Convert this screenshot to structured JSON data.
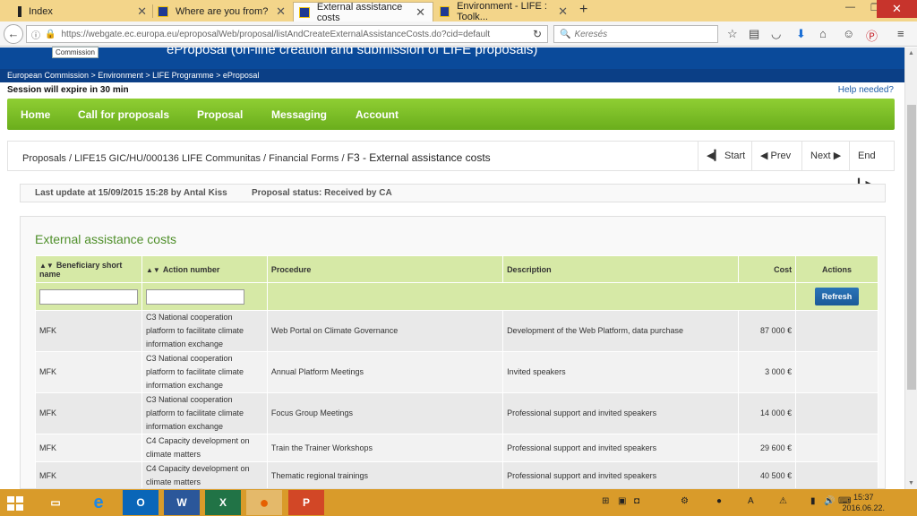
{
  "browser": {
    "tabs": [
      {
        "label": "Index",
        "active": false
      },
      {
        "label": "Where are you from?",
        "active": false
      },
      {
        "label": "External assistance costs",
        "active": true
      },
      {
        "label": "Environment - LIFE : Toolk...",
        "active": false
      }
    ],
    "url": "https://webgate.ec.europa.eu/eproposalWeb/proposal/listAndCreateExternalAssistanceCosts.do?cid=default",
    "search_placeholder": "Keresés"
  },
  "page": {
    "header_title": "eProposal (on-line creation and submission of LIFE proposals)",
    "commission_tag": "Commission",
    "breadcrumb": "European Commission > Environment > LIFE Programme > eProposal",
    "session": "Session will expire in 30 min",
    "help": "Help needed?"
  },
  "menu": {
    "items": [
      "Home",
      "Call for proposals",
      "Proposal",
      "Messaging",
      "Account"
    ]
  },
  "crumbs": {
    "proposals": "Proposals",
    "proposal_id": "LIFE15 GIC/HU/000136 LIFE Communitas",
    "financial": "Financial Forms",
    "current": "F3 - External assistance costs",
    "sep": "/"
  },
  "pager": {
    "start": "Start",
    "prev": "Prev",
    "next": "Next",
    "end": "End"
  },
  "info": {
    "last_update": "Last update at 15/09/2015 15:28 by Antal Kiss",
    "status": "Proposal status: Received by CA"
  },
  "table": {
    "title": "External assistance costs",
    "headers": {
      "beneficiary": "Beneficiary short name",
      "action": "Action number",
      "procedure": "Procedure",
      "description": "Description",
      "cost": "Cost",
      "actions": "Actions"
    },
    "refresh_label": "Refresh",
    "rows": [
      {
        "beneficiary": "MFK",
        "action": "C3 National cooperation platform to facilitate climate information exchange",
        "procedure": "Web Portal on Climate Governance",
        "description": "Development of the Web Platform, data purchase",
        "cost": "87 000 €"
      },
      {
        "beneficiary": "MFK",
        "action": "C3 National cooperation platform to facilitate climate information exchange",
        "procedure": "Annual Platform Meetings",
        "description": "Invited speakers",
        "cost": "3 000 €"
      },
      {
        "beneficiary": "MFK",
        "action": "C3 National cooperation platform to facilitate climate information exchange",
        "procedure": "Focus Group Meetings",
        "description": "Professional support and invited speakers",
        "cost": "14 000 €"
      },
      {
        "beneficiary": "MFK",
        "action": "C4 Capacity development on climate matters",
        "procedure": "Train the Trainer Workshops",
        "description": "Professional support and invited speakers",
        "cost": "29 600 €"
      },
      {
        "beneficiary": "MFK",
        "action": "C4 Capacity development on climate matters",
        "procedure": "Thematic regional trainings",
        "description": "Professional support and invited speakers",
        "cost": "40 500 €"
      }
    ]
  },
  "taskbar": {
    "time": "15:37",
    "date": "2016.06.22."
  }
}
